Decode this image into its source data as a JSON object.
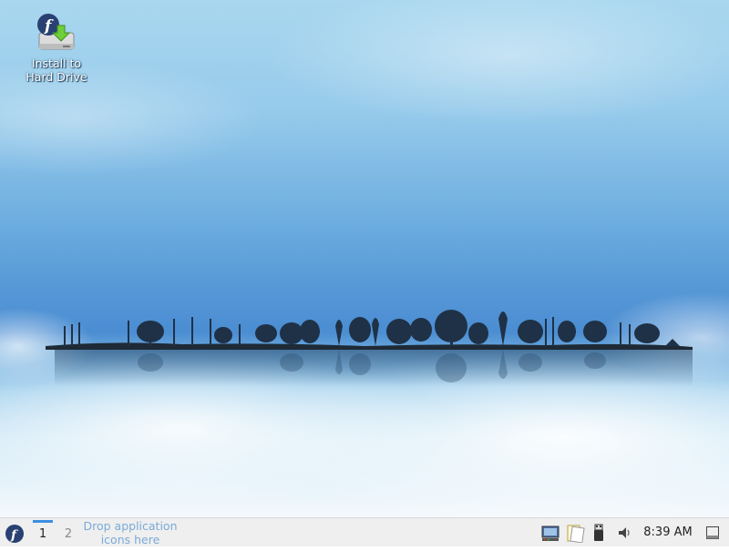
{
  "desktop": {
    "icons": [
      {
        "label": "Install to\nHard Drive",
        "icon": "fedora-install-drive-icon"
      }
    ]
  },
  "panel": {
    "launcher_icon": "fedora-logo-icon",
    "desktops": [
      {
        "label": "1",
        "active": true
      },
      {
        "label": "2",
        "active": false
      }
    ],
    "drop_hint": "Drop application icons here",
    "tray_icons": [
      "display-network-icon",
      "clipboard-icon",
      "usb-device-icon",
      "volume-icon"
    ],
    "clock": "8:39 AM",
    "show_desktop_icon": "show-desktop-icon"
  },
  "colors": {
    "panel_bg": "#efefef",
    "accent": "#3d8ee0",
    "hint_text": "#7aaad8"
  }
}
